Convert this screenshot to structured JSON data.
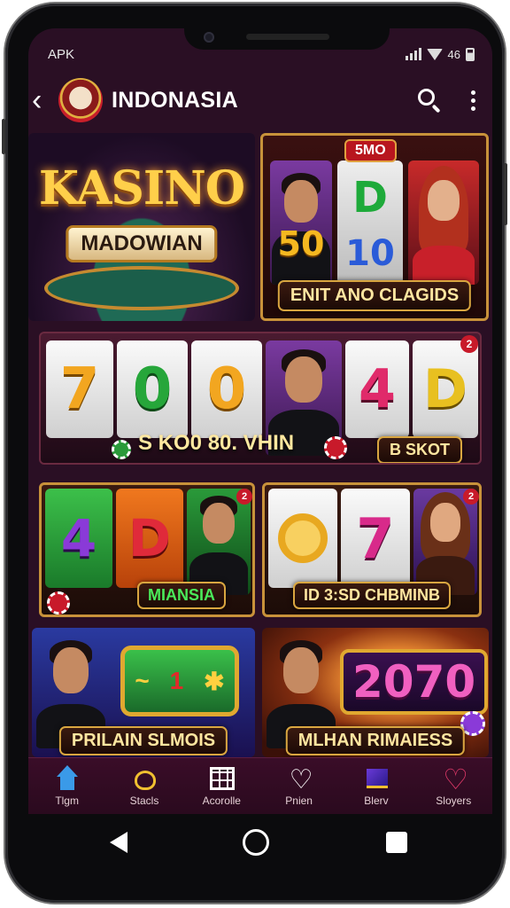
{
  "status_bar": {
    "carrier": "APK",
    "network": "46"
  },
  "app_bar": {
    "title": "INDONASIA",
    "logo_text": "KASINO"
  },
  "tiles": [
    {
      "id": "kasino",
      "title_line1": "KASINO",
      "title_line2": "MADOWIAN"
    },
    {
      "id": "enit",
      "badge": "5MO",
      "numbers": [
        "50",
        "D",
        "10"
      ],
      "label": "ENIT ANO CLAGIDS"
    },
    {
      "id": "big-slot",
      "reels": [
        "7",
        "0",
        "0",
        "4",
        "D"
      ],
      "badge": "2",
      "label_left": "S KO0 80. VHIN",
      "label_right": "B SKOT"
    },
    {
      "id": "miansia",
      "reels": [
        "4",
        "D"
      ],
      "badge": "2",
      "label": "MIANSIA"
    },
    {
      "id": "chbminb",
      "reels": [
        "7"
      ],
      "badge": "2",
      "label": "ID 3:SD CHBMINB"
    },
    {
      "id": "prilain",
      "label": "PRILAIN SLMOIS"
    },
    {
      "id": "mlhan",
      "number": "2070",
      "label": "MLHAN RIMAIESS"
    }
  ],
  "bottom_nav": [
    {
      "label": "Tlgm",
      "icon": "home-icon"
    },
    {
      "label": "Stacls",
      "icon": "bag-icon"
    },
    {
      "label": "Acorolle",
      "icon": "grid-icon"
    },
    {
      "label": "Pnien",
      "icon": "heart-icon"
    },
    {
      "label": "Blerv",
      "icon": "chart-icon"
    },
    {
      "label": "Sloyers",
      "icon": "heart-outline-icon"
    }
  ],
  "colors": {
    "background": "#2a0f24",
    "gold": "#d9a640",
    "accent_pink": "#e23a6a"
  }
}
